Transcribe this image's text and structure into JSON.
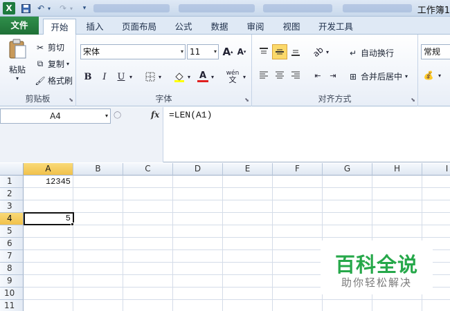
{
  "window": {
    "title": "工作簿1"
  },
  "ribbon_tabs": [
    "文件",
    "开始",
    "插入",
    "页面布局",
    "公式",
    "数据",
    "审阅",
    "视图",
    "开发工具"
  ],
  "active_tab": "开始",
  "clipboard": {
    "paste": "粘贴",
    "cut": "剪切",
    "copy": "复制",
    "format_painter": "格式刷",
    "label": "剪贴板"
  },
  "font": {
    "name": "宋体",
    "size": "11",
    "label": "字体",
    "bold": "B",
    "italic": "I",
    "underline": "U",
    "grow": "A",
    "shrink": "A",
    "color_a": "A",
    "phonetic": "wén"
  },
  "alignment": {
    "wrap_text": "自动换行",
    "merge_center": "合并后居中",
    "label": "对齐方式"
  },
  "number": {
    "format": "常规"
  },
  "formula_bar": {
    "name_box": "A4",
    "fx": "fx",
    "formula": "=LEN(A1)"
  },
  "sheet": {
    "columns": [
      "A",
      "B",
      "C",
      "D",
      "E",
      "F",
      "G",
      "H",
      "I"
    ],
    "rows": [
      "1",
      "2",
      "3",
      "4",
      "5",
      "6",
      "7",
      "8",
      "9",
      "10",
      "11"
    ],
    "selected_column": "A",
    "selected_row": "4",
    "cells": {
      "A1": "12345",
      "A4": "5"
    }
  },
  "watermark": {
    "title": "百科全说",
    "subtitle": "助你轻松解决"
  },
  "colors": {
    "file_tab": "#1f7036",
    "selected_header": "#f1c14b",
    "watermark_green": "#26a84a"
  }
}
